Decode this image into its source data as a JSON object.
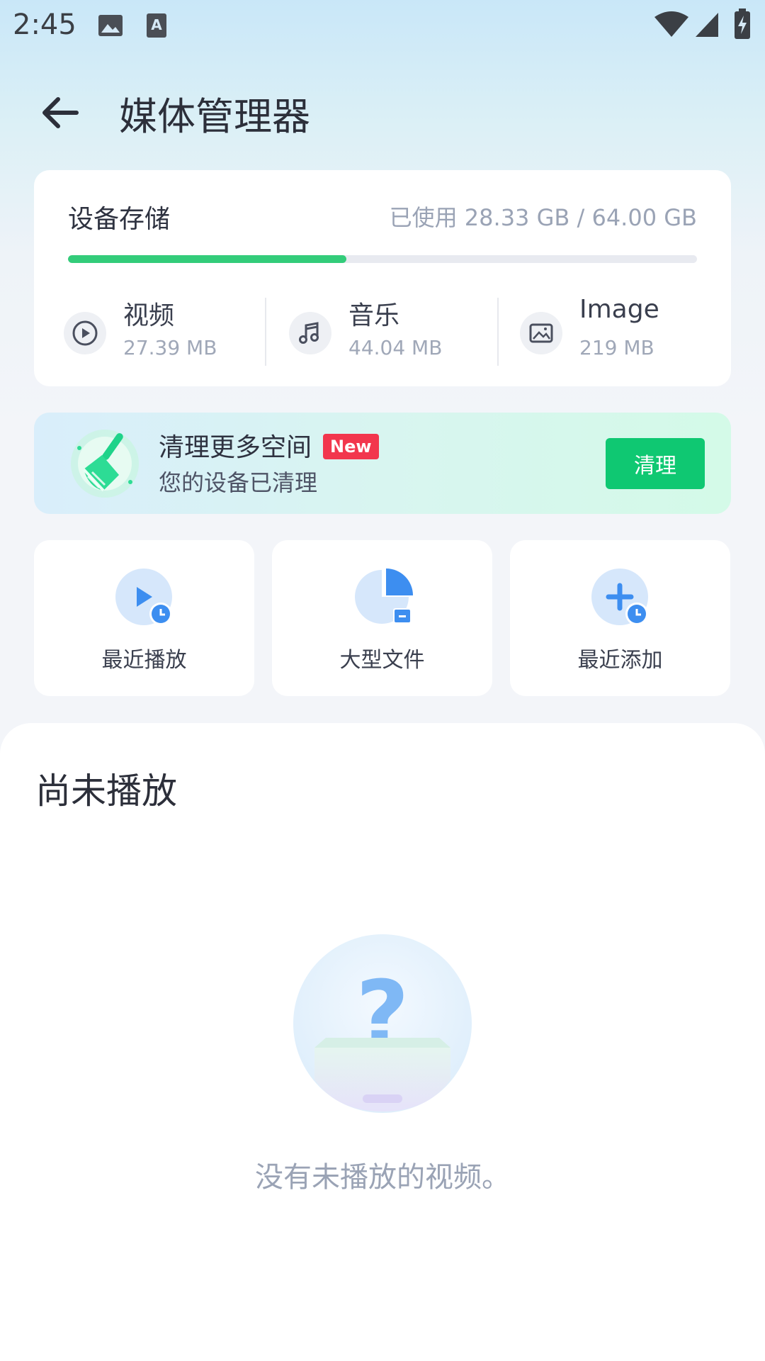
{
  "status_bar": {
    "time": "2:45"
  },
  "header": {
    "title": "媒体管理器"
  },
  "storage": {
    "title": "设备存储",
    "used_text": "已使用 28.33 GB / 64.00 GB",
    "used_fraction": 0.4427,
    "categories": [
      {
        "name": "视频",
        "size": "27.39 MB",
        "icon": "play-circle-icon"
      },
      {
        "name": "音乐",
        "size": "44.04 MB",
        "icon": "music-note-icon"
      },
      {
        "name": "Image",
        "size": "219 MB",
        "icon": "image-icon"
      }
    ]
  },
  "clean": {
    "title": "清理更多空间",
    "badge": "New",
    "subtitle": "您的设备已清理",
    "button": "清理"
  },
  "quick_actions": [
    {
      "label": "最近播放",
      "icon": "recent-play-icon"
    },
    {
      "label": "大型文件",
      "icon": "large-file-icon"
    },
    {
      "label": "最近添加",
      "icon": "recent-add-icon"
    }
  ],
  "section": {
    "title": "尚未播放",
    "empty_message": "没有未播放的视频。"
  },
  "colors": {
    "accent_green": "#0fc872",
    "progress_green": "#33cc7a",
    "badge_red": "#f2364d",
    "quick_icon_blue": "#3d8ef0"
  }
}
